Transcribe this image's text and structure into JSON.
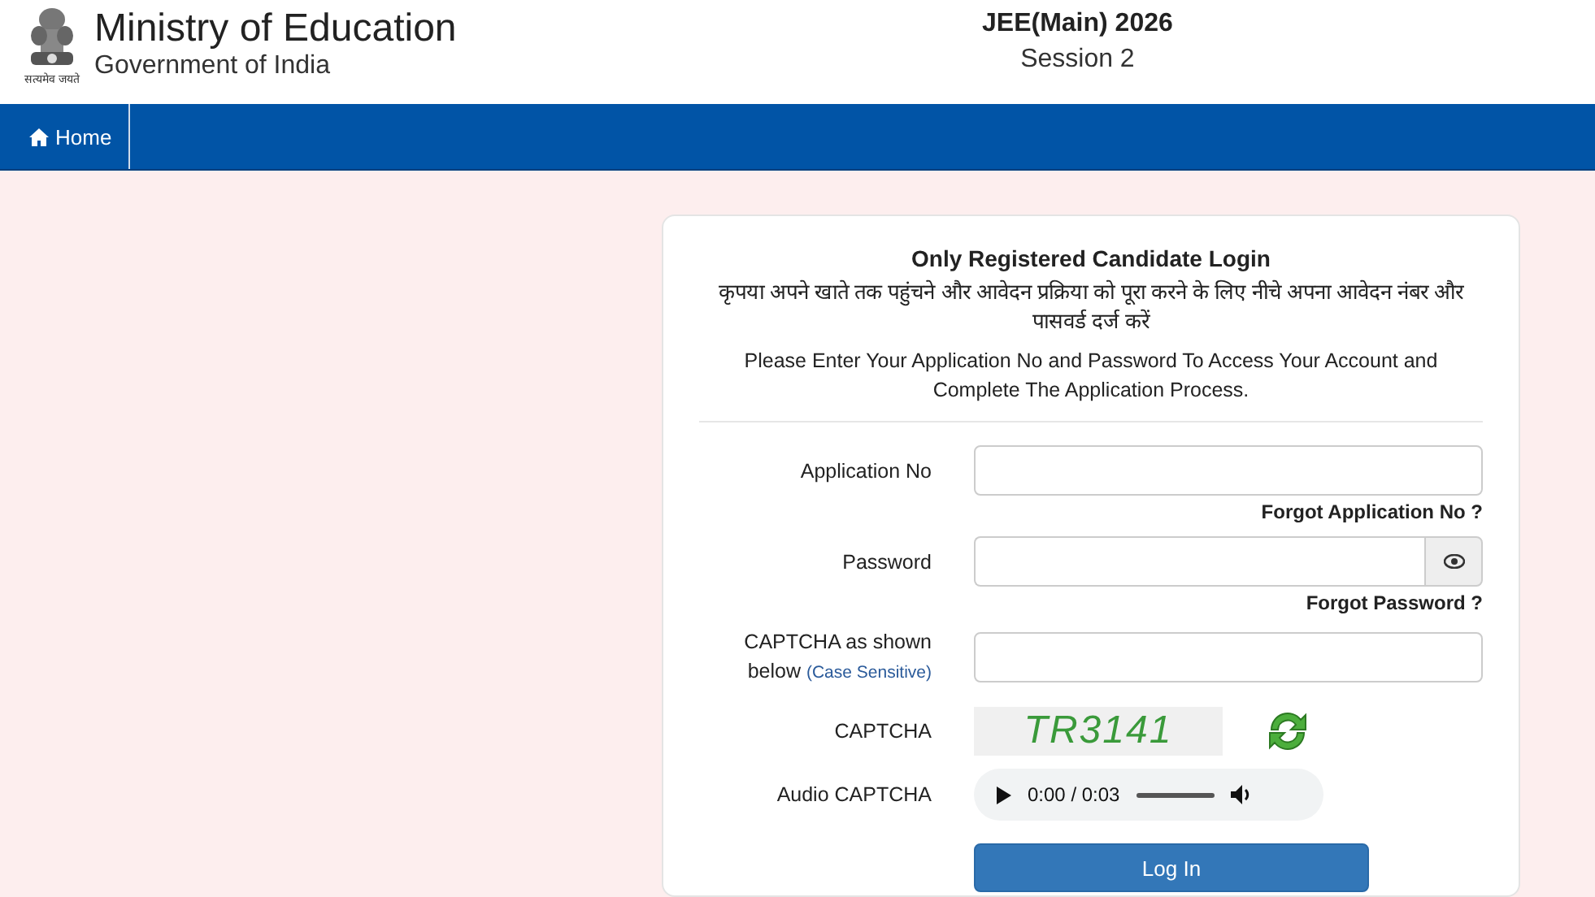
{
  "header": {
    "motto": "सत्यमेव जयते",
    "ministry": "Ministry of Education",
    "government": "Government of India",
    "exam": "JEE(Main) 2026",
    "session": "Session 2"
  },
  "nav": {
    "items": [
      {
        "label": "Home",
        "selected": true
      }
    ]
  },
  "login": {
    "title": "Only Registered Candidate Login",
    "hindi_instruction": "कृपया अपने खाते तक पहुंचने और आवेदन प्रक्रिया को पूरा करने के लिए नीचे अपना आवेदन नंबर और पासवर्ड दर्ज करें",
    "instruction": "Please Enter Your Application No and Password To Access Your Account and Complete The Application Process.",
    "fields": [
      {
        "kind": "text",
        "label": "Application No",
        "link": "Forgot Application No ?"
      },
      {
        "kind": "password",
        "label": "Password",
        "link": "Forgot Password ?"
      },
      {
        "kind": "captcha-input",
        "label": "CAPTCHA as shown below",
        "hint": "(Case Sensitive)"
      }
    ],
    "captcha": {
      "label": "CAPTCHA",
      "code": "TR3141"
    },
    "audio": {
      "label": "Audio CAPTCHA",
      "time": "0:00 / 0:03"
    },
    "submit": "Log In"
  }
}
